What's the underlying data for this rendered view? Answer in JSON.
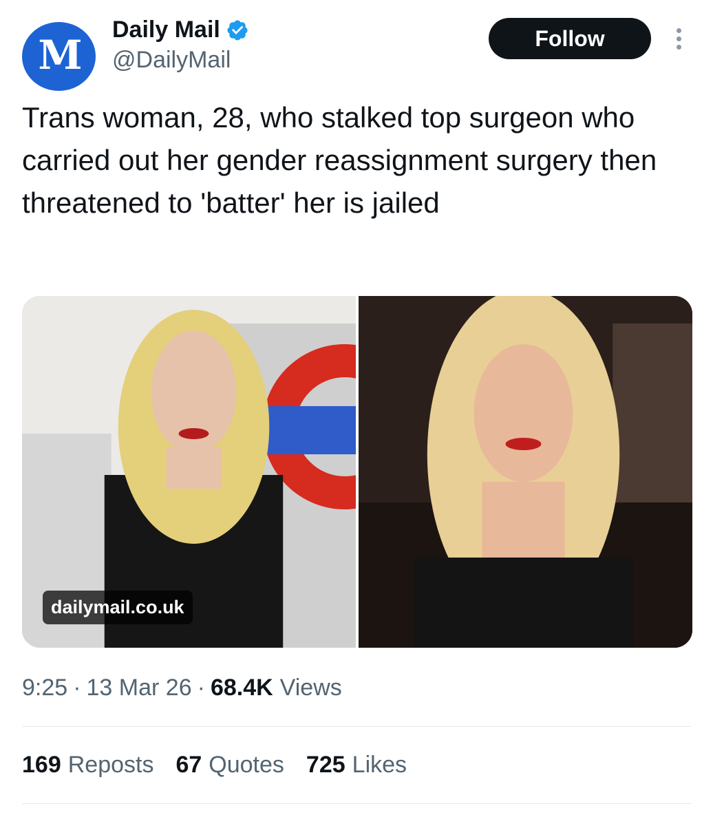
{
  "author": {
    "avatar_letter": "M",
    "display_name": "Daily Mail",
    "handle": "@DailyMail",
    "verified": true,
    "brand_color": "#1d63d3",
    "verified_color": "#1d9bf0"
  },
  "header": {
    "follow_label": "Follow",
    "more_icon": "more-vertical-icon"
  },
  "tweet": {
    "text": "Trans woman, 28, who stalked top surgeon who carried out her gender reassignment surgery then threatened to 'batter' her is jailed"
  },
  "media": {
    "source_label": "dailymail.co.uk",
    "photos": [
      "photo-left",
      "photo-right"
    ]
  },
  "meta": {
    "time": "9:25",
    "separator": "·",
    "date": "13 Mar 26",
    "views_count": "68.4K",
    "views_label": "Views"
  },
  "stats": {
    "reposts_count": "169",
    "reposts_label": "Reposts",
    "quotes_count": "67",
    "quotes_label": "Quotes",
    "likes_count": "725",
    "likes_label": "Likes"
  }
}
